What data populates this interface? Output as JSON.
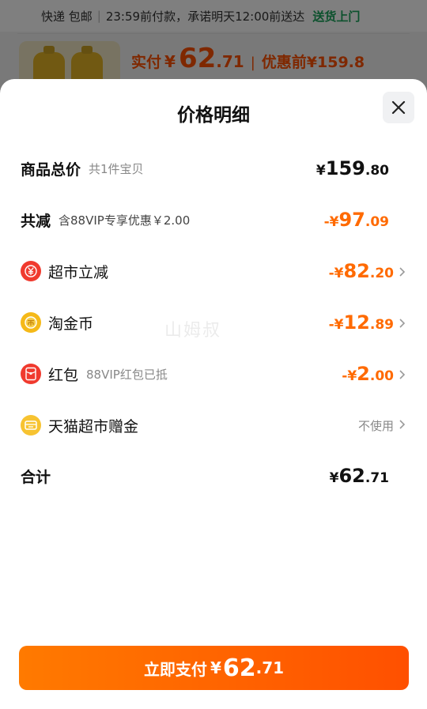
{
  "background": {
    "shipping": {
      "method": "快递 包邮",
      "promise": "23:59前付款，承诺明天12:00前送达",
      "tag": "送货上门"
    },
    "price": {
      "paid_label": "实付",
      "currency": "¥",
      "paid_int": "62",
      "paid_dec": ".71",
      "before_label": "优惠前",
      "before_value": "¥159.8"
    }
  },
  "sheet": {
    "title": "价格明细",
    "rows": {
      "total": {
        "label": "商品总价",
        "sub": "共1件宝贝",
        "sign": "¥",
        "int": "159",
        "dec": ".80"
      },
      "discount": {
        "label": "共减",
        "sub": "含88VIP专享优惠￥2.00",
        "sign": "-¥",
        "int": "97",
        "dec": ".09"
      },
      "supermarket": {
        "label": "超市立减",
        "sign": "-¥",
        "int": "82",
        "dec": ".20"
      },
      "coin": {
        "label": "淘金币",
        "sign": "-¥",
        "int": "12",
        "dec": ".89"
      },
      "redpacket": {
        "label": "红包",
        "sub": "88VIP红包已抵",
        "sign": "-¥",
        "int": "2",
        "dec": ".00"
      },
      "gift": {
        "label": "天猫超市赠金",
        "value": "不使用"
      },
      "sum": {
        "label": "合计",
        "sign": "¥",
        "int": "62",
        "dec": ".71"
      }
    },
    "watermark": "山姆叔",
    "pay_button": {
      "label": "立即支付",
      "currency": "¥",
      "int": "62",
      "dec": ".71"
    }
  },
  "colors": {
    "accent": "#ff5000",
    "green": "#19a35a",
    "coin_gold": "#f5b918",
    "red_icon": "#f03a2e"
  },
  "icons": [
    "close-icon",
    "yuan-down-icon",
    "coin-icon",
    "red-packet-icon",
    "gift-card-icon",
    "chevron-right-icon"
  ]
}
